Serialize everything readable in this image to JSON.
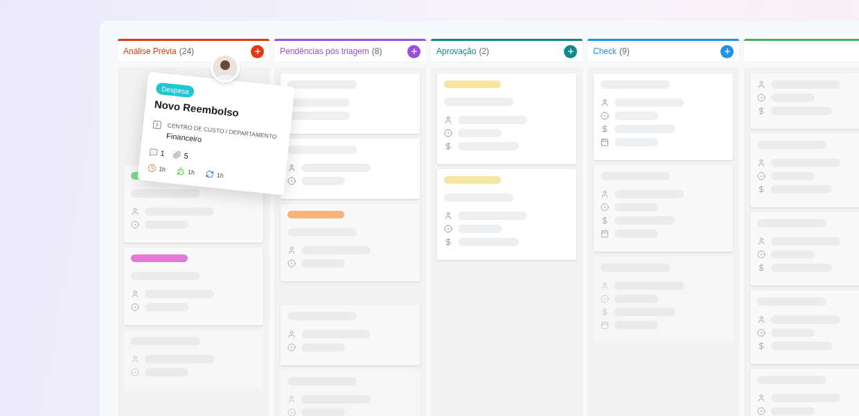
{
  "columns": [
    {
      "title": "Análise Prévia",
      "count": "(24)",
      "color": "#e03a16",
      "dragged_card": {
        "tag": "Despesa",
        "title": "Novo Reembolso",
        "field_label": "CENTRO DE CUSTO / DEPARTAMENTO",
        "field_value": "Financeiro",
        "comments": "1",
        "attachments": "5",
        "timers": [
          {
            "kind": "deadline",
            "value": "1h"
          },
          {
            "kind": "elapsed",
            "value": "1h"
          },
          {
            "kind": "cycle",
            "value": "1h"
          }
        ]
      },
      "cards": [
        {
          "kind": "light",
          "color": "#7ddc8a",
          "title_bar": true,
          "fields": [
            {
              "kind": "person"
            },
            {
              "kind": "status"
            }
          ]
        },
        {
          "kind": "light",
          "color": "#e27ad5",
          "title_bar": true,
          "fields": [
            {
              "kind": "person"
            },
            {
              "kind": "status"
            }
          ]
        },
        {
          "kind": "faint",
          "title_bar": true,
          "fields": [
            {
              "kind": "person"
            },
            {
              "kind": "status"
            }
          ]
        }
      ]
    },
    {
      "title": "Pendências pós triagem",
      "count": "(8)",
      "color": "#9a4fe0",
      "cards": [
        {
          "kind": "white",
          "title_bar": true,
          "fields": [
            {
              "kind": "blank"
            },
            {
              "kind": "blank"
            }
          ]
        },
        {
          "kind": "white",
          "title_bar": true,
          "fields": [
            {
              "kind": "person"
            },
            {
              "kind": "status"
            }
          ]
        },
        {
          "kind": "light",
          "color": "#f9b27a",
          "title_bar": true,
          "fields": [
            {
              "kind": "person"
            },
            {
              "kind": "status"
            }
          ]
        },
        {
          "kind": "gap"
        },
        {
          "kind": "light",
          "title_bar": true,
          "fields": [
            {
              "kind": "person"
            },
            {
              "kind": "status"
            }
          ]
        },
        {
          "kind": "faint",
          "title_bar": true,
          "fields": [
            {
              "kind": "person"
            },
            {
              "kind": "status"
            }
          ]
        }
      ]
    },
    {
      "title": "Aprovação",
      "count": "(2)",
      "color": "#0e8a8c",
      "cards": [
        {
          "kind": "white",
          "color": "#f5e6a0",
          "title_bar": true,
          "fields": [
            {
              "kind": "person"
            },
            {
              "kind": "status"
            },
            {
              "kind": "money"
            }
          ]
        },
        {
          "kind": "white",
          "color": "#f5e6a0",
          "title_bar": true,
          "fields": [
            {
              "kind": "person"
            },
            {
              "kind": "status"
            },
            {
              "kind": "money"
            }
          ]
        }
      ]
    },
    {
      "title": "Check",
      "count": "(9)",
      "color": "#1f93e8",
      "cards": [
        {
          "kind": "white",
          "title_bar": true,
          "fields": [
            {
              "kind": "person"
            },
            {
              "kind": "status"
            },
            {
              "kind": "money"
            },
            {
              "kind": "calendar"
            }
          ]
        },
        {
          "kind": "light",
          "title_bar": true,
          "fields": [
            {
              "kind": "person"
            },
            {
              "kind": "status"
            },
            {
              "kind": "money"
            },
            {
              "kind": "calendar"
            }
          ]
        },
        {
          "kind": "faint",
          "title_bar": true,
          "fields": [
            {
              "kind": "person"
            },
            {
              "kind": "status"
            },
            {
              "kind": "money"
            },
            {
              "kind": "calendar"
            }
          ]
        }
      ]
    },
    {
      "color": "#4caf50",
      "cards": [
        {
          "kind": "light",
          "title_bar": false,
          "fields": [
            {
              "kind": "person"
            },
            {
              "kind": "status"
            },
            {
              "kind": "money"
            }
          ]
        },
        {
          "kind": "light",
          "title_bar": true,
          "fields": [
            {
              "kind": "person"
            },
            {
              "kind": "status"
            },
            {
              "kind": "money"
            }
          ]
        },
        {
          "kind": "light",
          "title_bar": true,
          "fields": [
            {
              "kind": "person"
            },
            {
              "kind": "status"
            },
            {
              "kind": "money"
            }
          ]
        },
        {
          "kind": "light",
          "title_bar": true,
          "fields": [
            {
              "kind": "person"
            },
            {
              "kind": "status"
            },
            {
              "kind": "money"
            }
          ]
        },
        {
          "kind": "light",
          "title_bar": true,
          "fields": [
            {
              "kind": "person"
            },
            {
              "kind": "status"
            }
          ]
        }
      ]
    }
  ]
}
